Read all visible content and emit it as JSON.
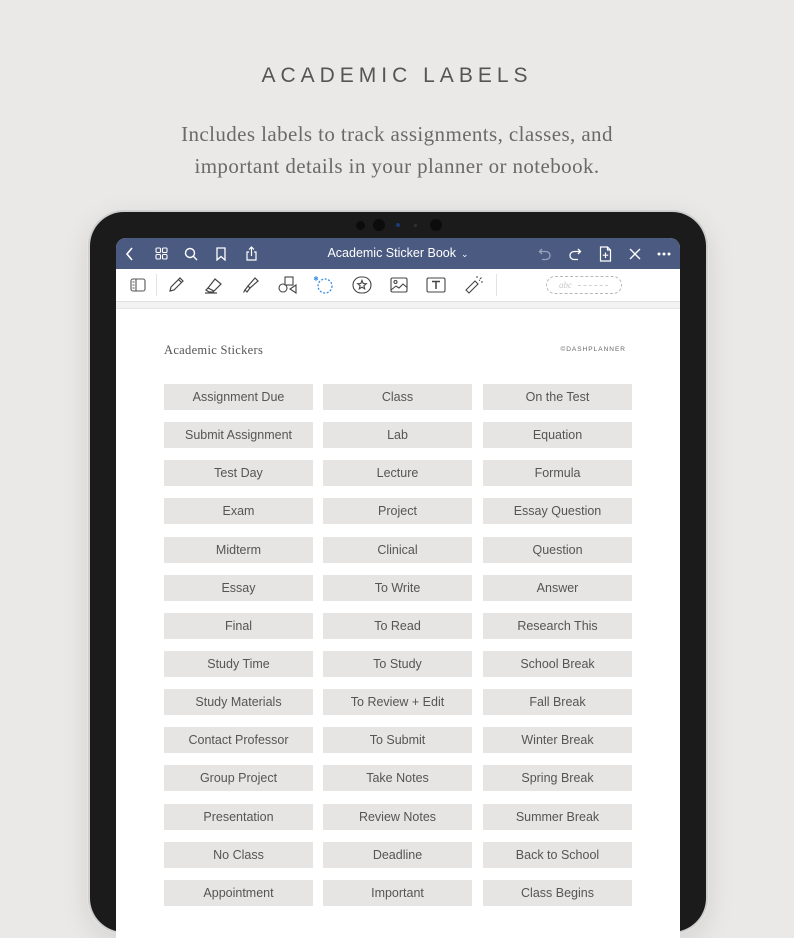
{
  "header": {
    "title": "ACADEMIC LABELS",
    "subtitle_line1": "Includes labels to track assignments, classes, and",
    "subtitle_line2": "important details in your planner or notebook."
  },
  "app": {
    "nav": {
      "title": "Academic Sticker Book",
      "left_icons": [
        "back-icon",
        "grid-icon",
        "search-icon",
        "bookmark-icon",
        "share-icon"
      ],
      "right_icons": [
        "undo-icon",
        "redo-icon",
        "add-page-icon",
        "close-icon",
        "more-icon"
      ],
      "bar_color": "#4a5a80"
    },
    "toolbar": {
      "tools": [
        "sidebar-icon",
        "pen-icon",
        "eraser-icon",
        "highlighter-icon",
        "shapes-icon",
        "lasso-icon",
        "sticker-icon",
        "image-icon",
        "text-icon",
        "laser-pointer-icon"
      ],
      "active_tool": "lasso-icon",
      "accent_color": "#3d8fe0",
      "handwriting_placeholder": "abc"
    },
    "page": {
      "title": "Academic Stickers",
      "brand": "©DASHPLANNER",
      "sticker_color": "#e6e5e3",
      "stickers": [
        [
          "Assignment Due",
          "Class",
          "On the Test"
        ],
        [
          "Submit Assignment",
          "Lab",
          "Equation"
        ],
        [
          "Test Day",
          "Lecture",
          "Formula"
        ],
        [
          "Exam",
          "Project",
          "Essay Question"
        ],
        [
          "Midterm",
          "Clinical",
          "Question"
        ],
        [
          "Essay",
          "To Write",
          "Answer"
        ],
        [
          "Final",
          "To Read",
          "Research This"
        ],
        [
          "Study Time",
          "To Study",
          "School Break"
        ],
        [
          "Study Materials",
          "To Review + Edit",
          "Fall Break"
        ],
        [
          "Contact Professor",
          "To Submit",
          "Winter Break"
        ],
        [
          "Group Project",
          "Take Notes",
          "Spring Break"
        ],
        [
          "Presentation",
          "Review Notes",
          "Summer Break"
        ],
        [
          "No Class",
          "Deadline",
          "Back to School"
        ],
        [
          "Appointment",
          "Important",
          "Class Begins"
        ]
      ]
    }
  }
}
